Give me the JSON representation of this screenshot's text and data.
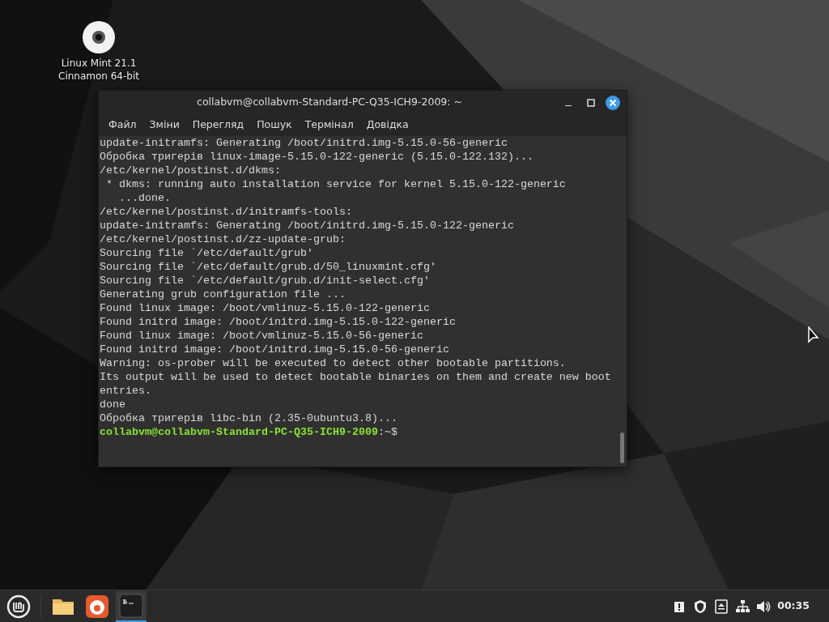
{
  "desktop_icons": [
    {
      "label": "Linux Mint 21.1 Cinnamon 64-bit"
    }
  ],
  "terminal": {
    "title": "collabvm@collabvm-Standard-PC-Q35-ICH9-2009: ~",
    "menu": [
      "Файл",
      "Зміни",
      "Перегляд",
      "Пошук",
      "Термінал",
      "Довідка"
    ],
    "lines": [
      "update-initramfs: Generating /boot/initrd.img-5.15.0-56-generic",
      "Обробка тригерів linux-image-5.15.0-122-generic (5.15.0-122.132)...",
      "/etc/kernel/postinst.d/dkms:",
      " * dkms: running auto installation service for kernel 5.15.0-122-generic",
      "   ...done.",
      "/etc/kernel/postinst.d/initramfs-tools:",
      "update-initramfs: Generating /boot/initrd.img-5.15.0-122-generic",
      "/etc/kernel/postinst.d/zz-update-grub:",
      "Sourcing file `/etc/default/grub'",
      "Sourcing file `/etc/default/grub.d/50_linuxmint.cfg'",
      "Sourcing file `/etc/default/grub.d/init-select.cfg'",
      "Generating grub configuration file ...",
      "Found linux image: /boot/vmlinuz-5.15.0-122-generic",
      "Found initrd image: /boot/initrd.img-5.15.0-122-generic",
      "Found linux image: /boot/vmlinuz-5.15.0-56-generic",
      "Found initrd image: /boot/initrd.img-5.15.0-56-generic",
      "Warning: os-prober will be executed to detect other bootable partitions.",
      "Its output will be used to detect bootable binaries on them and create new boot",
      "entries.",
      "done",
      "Обробка тригерів libc-bin (2.35-0ubuntu3.8)..."
    ],
    "prompt": {
      "user_host": "collabvm@collabvm-Standard-PC-Q35-ICH9-2009",
      "suffix": ":~$"
    }
  },
  "taskbar": {
    "apps": [
      {
        "kind": "files",
        "active": false
      },
      {
        "kind": "browser",
        "active": false
      },
      {
        "kind": "terminal",
        "active": true
      }
    ],
    "tray": [
      {
        "kind": "notice"
      },
      {
        "kind": "shield"
      },
      {
        "kind": "eject"
      },
      {
        "kind": "network"
      },
      {
        "kind": "volume"
      }
    ],
    "clock": "00:35"
  }
}
